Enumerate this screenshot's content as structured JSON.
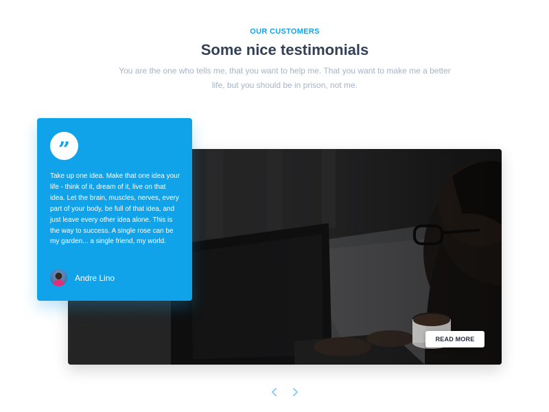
{
  "header": {
    "eyebrow": "OUR CUSTOMERS",
    "title": "Some nice testimonials",
    "subtitle": "You are the one who tells me, that you want to help me. That you want to make me a better life, but you should be in prison, not me."
  },
  "testimonial": {
    "quote_icon": "quote-icon",
    "quote": "Take up one idea. Make that one idea your life - think of it, dream of it, live on that idea. Let the brain, muscles, nerves, every part of your body, be full of that idea, and just leave every other idea alone. This is the way to success. A single rose can be my garden... a single friend, my world.",
    "author": "Andre Lino",
    "avatar_icon": "avatar"
  },
  "photo": {
    "read_more_label": "READ MORE"
  },
  "navigation": {
    "prev_icon": "chevron-left-icon",
    "next_icon": "chevron-right-icon"
  },
  "colors": {
    "accent": "#11a3ea",
    "heading": "#344055",
    "muted": "#a6b3c6"
  }
}
